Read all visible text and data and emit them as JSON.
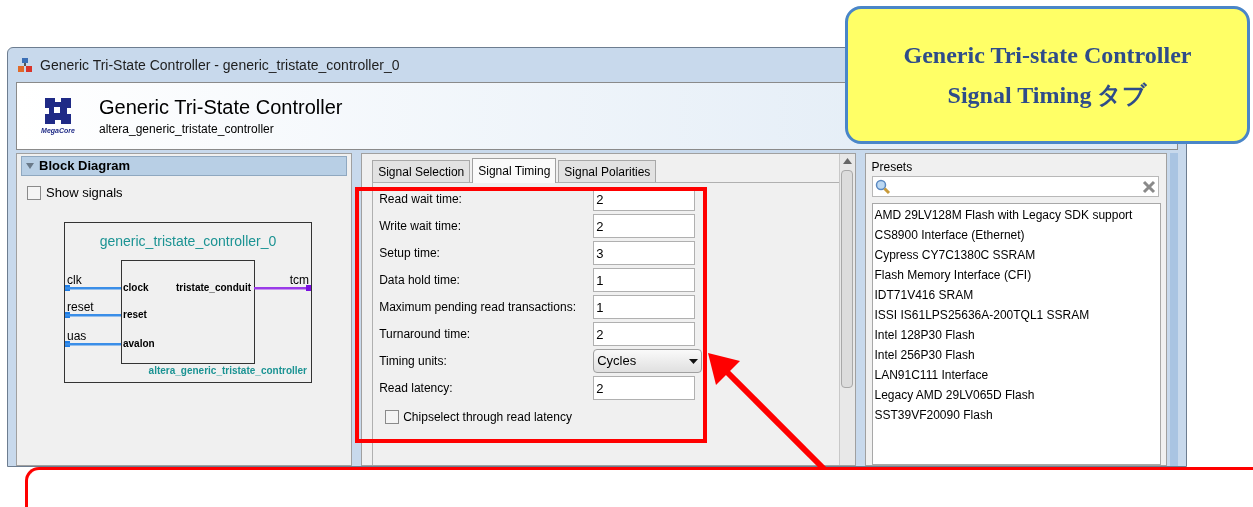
{
  "window": {
    "title": "Generic Tri-State Controller - generic_tristate_controller_0"
  },
  "header": {
    "logo_text": "MegaCore",
    "title": "Generic Tri-State Controller",
    "subtitle": "altera_generic_tristate_controller"
  },
  "block_diagram": {
    "title": "Block Diagram",
    "expanded": true,
    "show_signals": {
      "label": "Show signals",
      "checked": false
    },
    "diagram": {
      "instance_name": "generic_tristate_controller_0",
      "module_name": "altera_generic_tristate_controller",
      "inputs": [
        {
          "signal": "clk",
          "port": "clock"
        },
        {
          "signal": "reset",
          "port": "reset"
        },
        {
          "signal": "uas",
          "port": "avalon"
        }
      ],
      "outputs": [
        {
          "signal": "tcm",
          "port": "tristate_conduit"
        }
      ]
    }
  },
  "tabs": [
    {
      "label": "Signal Selection",
      "selected": false
    },
    {
      "label": "Signal Timing",
      "selected": true
    },
    {
      "label": "Signal Polarities",
      "selected": false
    }
  ],
  "fields": [
    {
      "kind": "text",
      "label": "Read wait time:",
      "value": "2"
    },
    {
      "kind": "text",
      "label": "Write wait time:",
      "value": "2"
    },
    {
      "kind": "text",
      "label": "Setup time:",
      "value": "3"
    },
    {
      "kind": "text",
      "label": "Data hold time:",
      "value": "1"
    },
    {
      "kind": "text",
      "label": "Maximum pending read transactions:",
      "value": "1"
    },
    {
      "kind": "text",
      "label": "Turnaround time:",
      "value": "2"
    },
    {
      "kind": "select",
      "label": "Timing units:",
      "value": "Cycles"
    },
    {
      "kind": "text",
      "label": "Read latency:",
      "value": "2"
    },
    {
      "kind": "checkbox",
      "label": "Chipselect through read latency",
      "checked": false
    }
  ],
  "presets": {
    "title": "Presets",
    "items": [
      "AMD 29LV128M Flash with Legacy SDK support",
      "CS8900 Interface (Ethernet)",
      "Cypress CY7C1380C SSRAM",
      "Flash Memory Interface (CFI)",
      "IDT71V416 SRAM",
      "ISSI IS61LPS25636A-200TQL1 SSRAM",
      "Intel 128P30 Flash",
      "Intel 256P30 Flash",
      "LAN91C111 Interface",
      "Legacy AMD 29LV065D Flash",
      "SST39VF20090 Flash"
    ]
  },
  "callout": {
    "lines": [
      "Generic Tri-state Controller",
      "Signal Timing タブ"
    ]
  }
}
